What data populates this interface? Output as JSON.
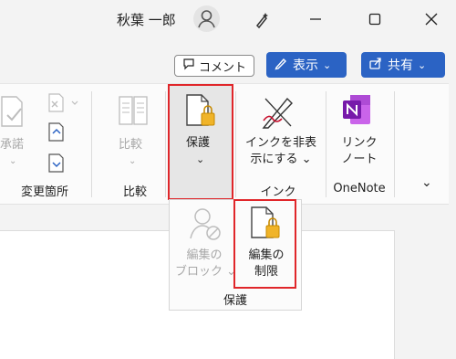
{
  "titlebar": {
    "user_name": "秋葉 一郎",
    "icons": [
      "user-avatar-icon",
      "pen-sparkle-icon",
      "minimize-icon",
      "maximize-icon",
      "close-icon"
    ]
  },
  "commands": {
    "comment_label": "コメント",
    "view_label": "表示",
    "share_label": "共有",
    "chevron": "⌄"
  },
  "ribbon": {
    "changes_group": {
      "accept_label": "承諾",
      "label": "変更箇所"
    },
    "compare_group": {
      "compare_label": "比較",
      "label": "比較"
    },
    "protect_group": {
      "protect_label": "保護",
      "chevron": "⌄"
    },
    "ink_group": {
      "hide_ink_line1": "インクを非表",
      "hide_ink_line2": "示にする ⌄",
      "label": "インク"
    },
    "onenote_group": {
      "link_line1": "リンク",
      "link_line2": "ノート",
      "label": "OneNote"
    },
    "collapse_chevron": "⌄"
  },
  "protect_dropdown": {
    "block_authors_line1": "編集の",
    "block_authors_line2": "ブロック ⌄",
    "restrict_editing_line1": "編集の",
    "restrict_editing_line2": "制限",
    "label": "保護"
  },
  "colors": {
    "accent_blue": "#2b63c4",
    "highlight_red": "#e0262a",
    "lock_gold": "#f0b429",
    "onenote_purple": "#7719aa"
  }
}
